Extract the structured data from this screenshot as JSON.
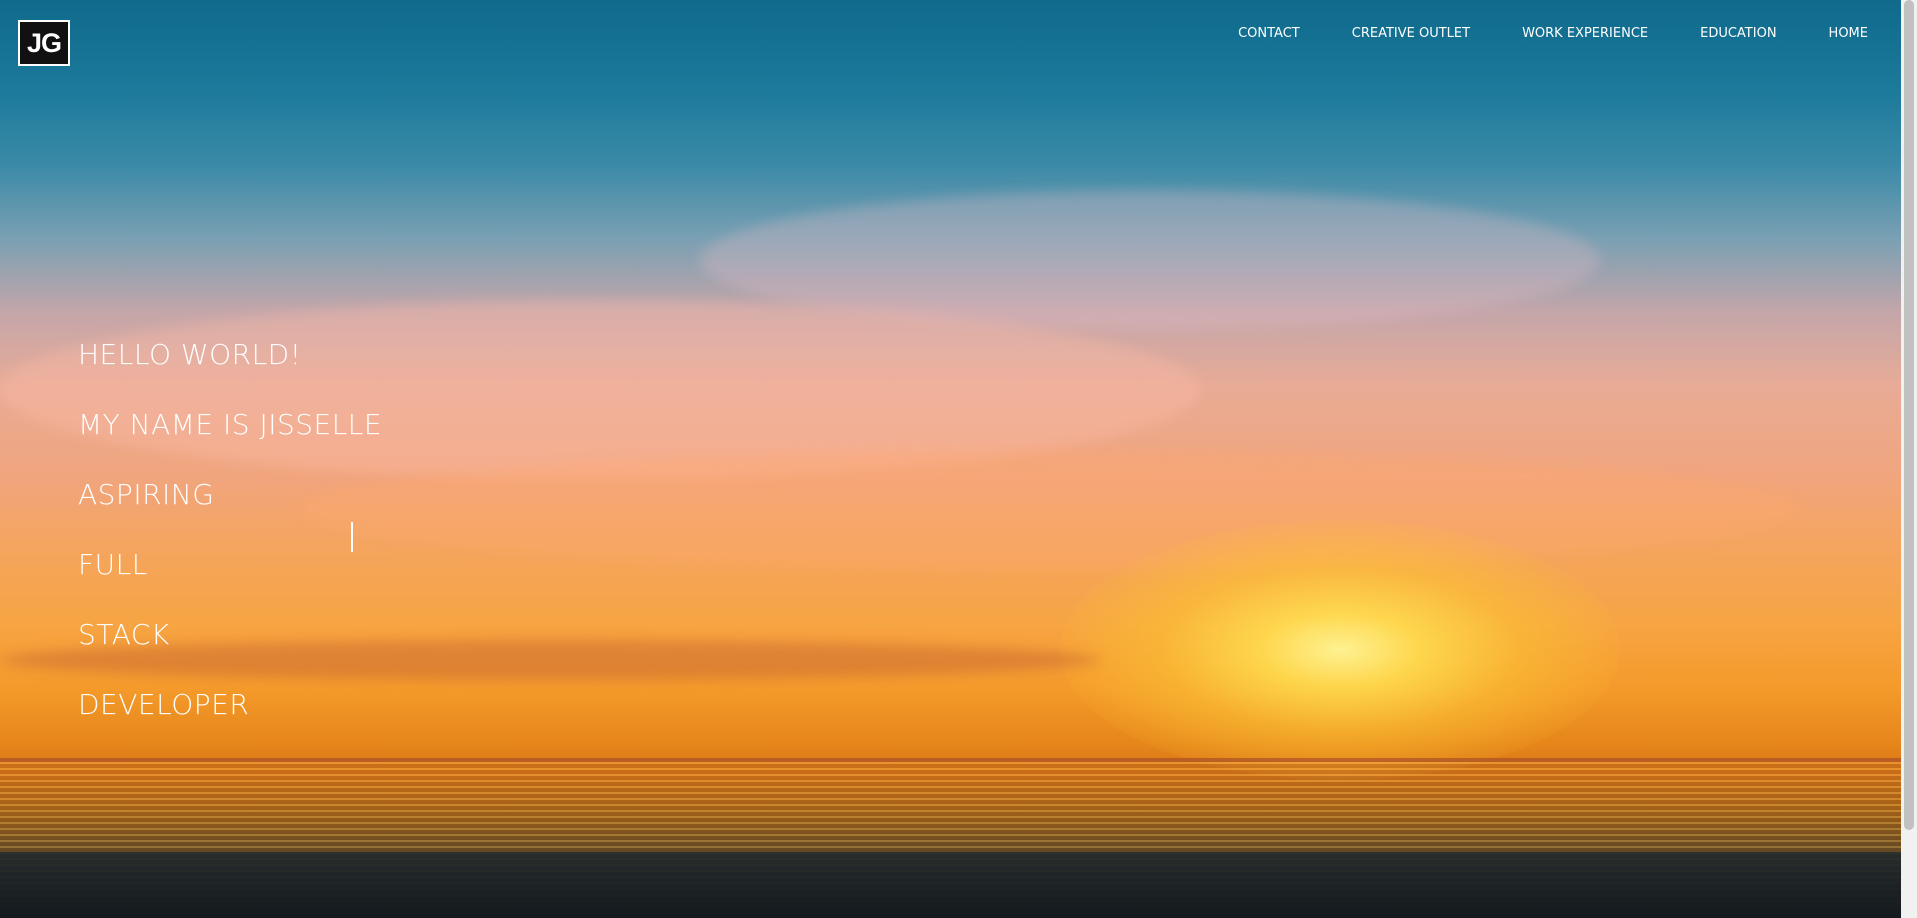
{
  "logo": {
    "text": "JG"
  },
  "nav": {
    "contact": "CONTACT",
    "creative_outlet": "CREATIVE OUTLET",
    "work_experience": "WORK EXPERIENCE",
    "education": "EDUCATION",
    "home": "HOME"
  },
  "intro": {
    "line1": "HELLO WORLD!",
    "line2": "MY NAME IS JISSELLE",
    "line3": "ASPIRING",
    "line4": "FULL",
    "line5": "STACK",
    "line6": "DEVELOPER"
  },
  "background": {
    "image": "sunset-over-ocean",
    "sky_top": "#0f6a8c",
    "sun_color": "#ffe050",
    "water_color": "#1c2327"
  }
}
